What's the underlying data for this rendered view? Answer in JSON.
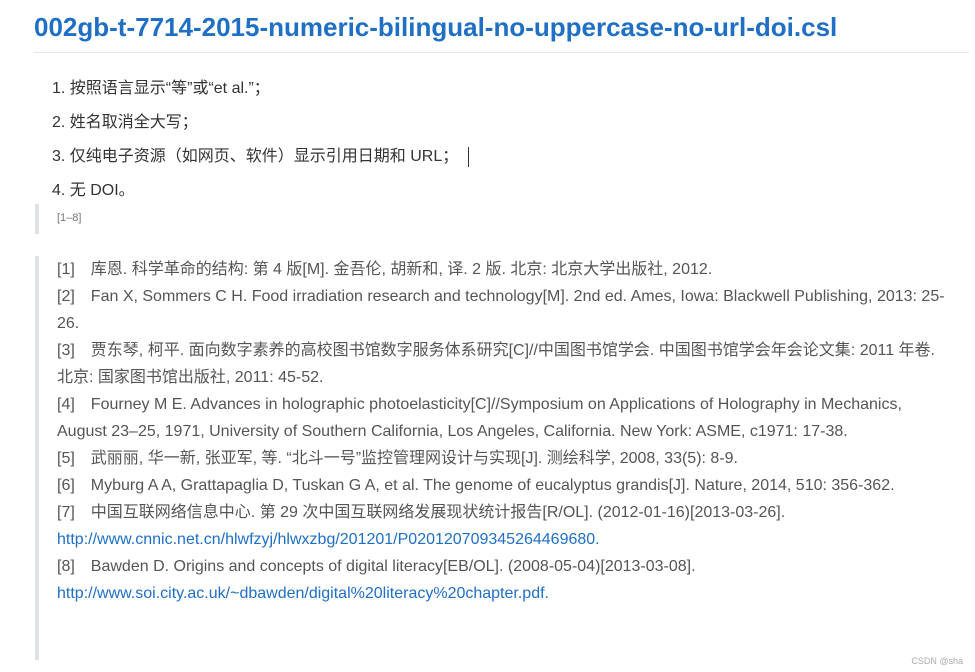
{
  "title": "002gb-t-7714-2015-numeric-bilingual-no-uppercase-no-url-doi.csl",
  "rules": [
    "1. 按照语言显示“等”或“et al.”；",
    "2. 姓名取消全大写；",
    "3. 仅纯电子资源（如网页、软件）显示引用日期和 URL；",
    "4. 无 DOI。"
  ],
  "citation_inline": "[1–8]",
  "references": [
    {
      "num": "[1]",
      "text": "库恩. 科学革命的结构: 第 4 版[M]. 金吾伦, 胡新和, 译. 2 版. 北京: 北京大学出版社, 2012.",
      "link": ""
    },
    {
      "num": "[2]",
      "text": "Fan X, Sommers C H. Food irradiation research and technology[M]. 2nd ed. Ames, Iowa: Blackwell Publishing, 2013: 25-26.",
      "link": ""
    },
    {
      "num": "[3]",
      "text": "贾东琴, 柯平. 面向数字素养的高校图书馆数字服务体系研究[C]//中国图书馆学会. 中国图书馆学会年会论文集: 2011 年卷. 北京: 国家图书馆出版社, 2011: 45-52.",
      "link": ""
    },
    {
      "num": "[4]",
      "text": "Fourney M E. Advances in holographic photoelasticity[C]//Symposium on Applications of Holography in Mechanics, August 23–25, 1971, University of Southern California, Los Angeles, California. New York: ASME, c1971: 17-38.",
      "link": ""
    },
    {
      "num": "[5]",
      "text": "武丽丽, 华一新, 张亚军, 等. “北斗一号”监控管理网设计与实现[J]. 测绘科学, 2008, 33(5): 8-9.",
      "link": ""
    },
    {
      "num": "[6]",
      "text": "Myburg A A, Grattapaglia D, Tuskan G A, et al. The genome of eucalyptus grandis[J]. Nature, 2014, 510: 356-362.",
      "link": ""
    },
    {
      "num": "[7]",
      "text": "中国互联网络信息中心. 第 29 次中国互联网络发展现状统计报告[R/OL]. (2012-01-16)[2013-03-26]. ",
      "link": "http://www.cnnic.net.cn/hlwfzyj/hlwxzbg/201201/P020120709345264469680."
    },
    {
      "num": "[8]",
      "text": "Bawden D. Origins and concepts of digital literacy[EB/OL]. (2008-05-04)[2013-03-08]. ",
      "link": "http://www.soi.city.ac.uk/~dbawden/digital%20literacy%20chapter.pdf."
    }
  ],
  "watermark": "CSDN @sha"
}
